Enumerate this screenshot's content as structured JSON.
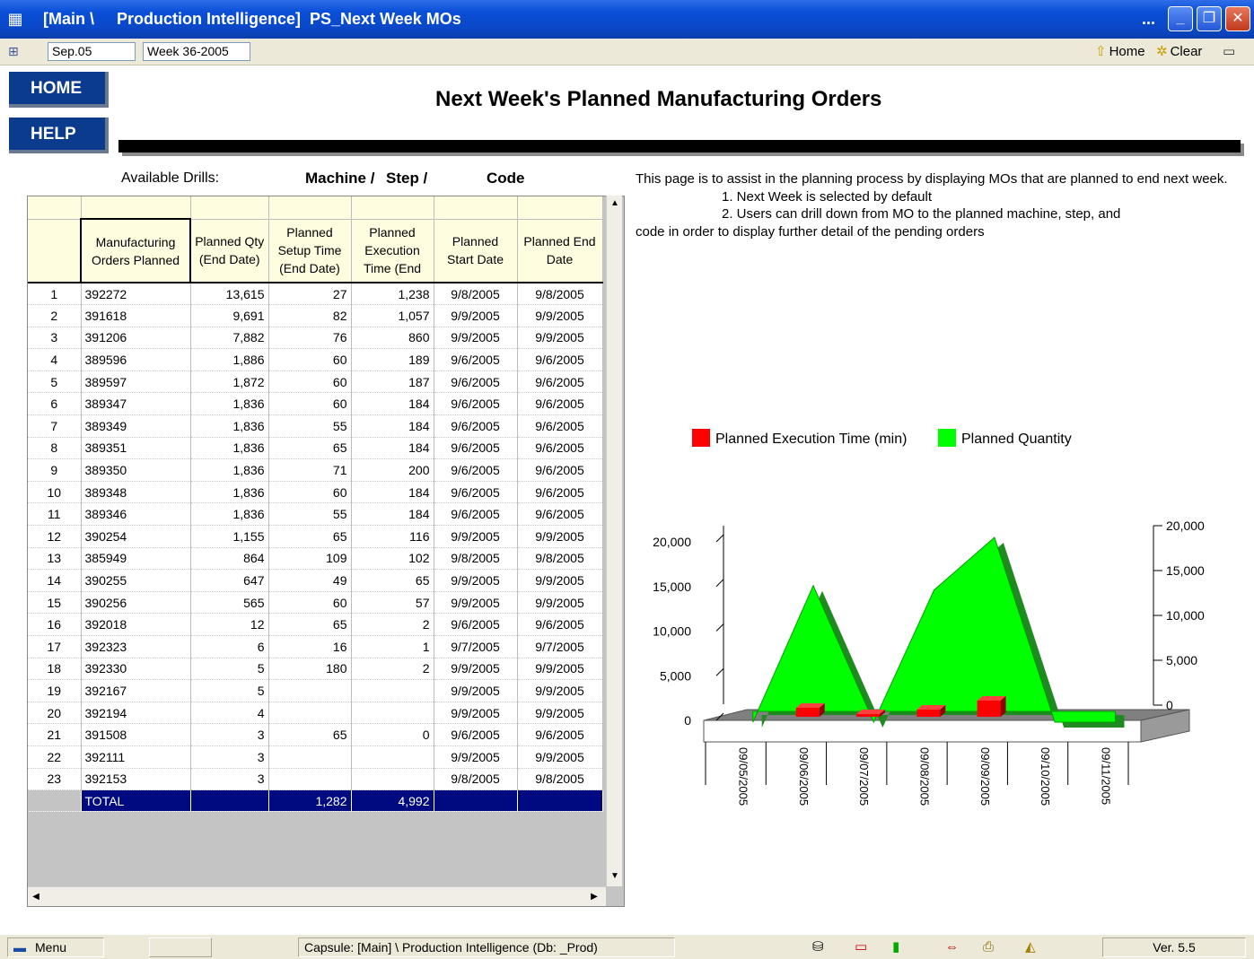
{
  "window": {
    "title": "[Main \\     Production Intelligence]  PS_Next Week MOs",
    "title_suffix": "...",
    "minimize": "_",
    "maximize": "❐",
    "close": "✕"
  },
  "toolbar": {
    "period": "Sep.05",
    "week": "Week 36-2005",
    "home_label": "Home",
    "clear_label": "Clear"
  },
  "nav": {
    "home": "HOME",
    "help": "HELP"
  },
  "page": {
    "title": "Next Week's Planned Manufacturing Orders"
  },
  "drills": {
    "label": "Available Drills:",
    "items": [
      "Machine /",
      "Step /",
      "Code"
    ]
  },
  "description": {
    "intro": "This page is to assist in the planning process by displaying MOs that are planned to end next week.",
    "items": [
      "1. Next Week is selected by default",
      "2. Users can drill down from MO to the planned machine, step, and"
    ],
    "tail": "code in order to display further detail of the pending orders"
  },
  "grid": {
    "headers": [
      "Manufacturing Orders Planned",
      "Planned Qty (End Date)",
      "Planned Setup Time (End Date)",
      "Planned Execution Time (End",
      "Planned Start Date",
      "Planned End Date"
    ],
    "rows": [
      [
        "1",
        "392272",
        "13,615",
        "27",
        "1,238",
        "9/8/2005",
        "9/8/2005"
      ],
      [
        "2",
        "391618",
        "9,691",
        "82",
        "1,057",
        "9/9/2005",
        "9/9/2005"
      ],
      [
        "3",
        "391206",
        "7,882",
        "76",
        "860",
        "9/9/2005",
        "9/9/2005"
      ],
      [
        "4",
        "389596",
        "1,886",
        "60",
        "189",
        "9/6/2005",
        "9/6/2005"
      ],
      [
        "5",
        "389597",
        "1,872",
        "60",
        "187",
        "9/6/2005",
        "9/6/2005"
      ],
      [
        "6",
        "389347",
        "1,836",
        "60",
        "184",
        "9/6/2005",
        "9/6/2005"
      ],
      [
        "7",
        "389349",
        "1,836",
        "55",
        "184",
        "9/6/2005",
        "9/6/2005"
      ],
      [
        "8",
        "389351",
        "1,836",
        "65",
        "184",
        "9/6/2005",
        "9/6/2005"
      ],
      [
        "9",
        "389350",
        "1,836",
        "71",
        "200",
        "9/6/2005",
        "9/6/2005"
      ],
      [
        "10",
        "389348",
        "1,836",
        "60",
        "184",
        "9/6/2005",
        "9/6/2005"
      ],
      [
        "11",
        "389346",
        "1,836",
        "55",
        "184",
        "9/6/2005",
        "9/6/2005"
      ],
      [
        "12",
        "390254",
        "1,155",
        "65",
        "116",
        "9/9/2005",
        "9/9/2005"
      ],
      [
        "13",
        "385949",
        "864",
        "109",
        "102",
        "9/8/2005",
        "9/8/2005"
      ],
      [
        "14",
        "390255",
        "647",
        "49",
        "65",
        "9/9/2005",
        "9/9/2005"
      ],
      [
        "15",
        "390256",
        "565",
        "60",
        "57",
        "9/9/2005",
        "9/9/2005"
      ],
      [
        "16",
        "392018",
        "12",
        "65",
        "2",
        "9/6/2005",
        "9/6/2005"
      ],
      [
        "17",
        "392323",
        "6",
        "16",
        "1",
        "9/7/2005",
        "9/7/2005"
      ],
      [
        "18",
        "392330",
        "5",
        "180",
        "2",
        "9/9/2005",
        "9/9/2005"
      ],
      [
        "19",
        "392167",
        "5",
        "",
        "",
        "9/9/2005",
        "9/9/2005"
      ],
      [
        "20",
        "392194",
        "4",
        "",
        "",
        "9/9/2005",
        "9/9/2005"
      ],
      [
        "21",
        "391508",
        "3",
        "65",
        "0",
        "9/6/2005",
        "9/6/2005"
      ],
      [
        "22",
        "392111",
        "3",
        "",
        "",
        "9/9/2005",
        "9/9/2005"
      ],
      [
        "23",
        "392153",
        "3",
        "",
        "",
        "9/8/2005",
        "9/8/2005"
      ]
    ],
    "total": [
      "",
      "TOTAL",
      "",
      "1,282",
      "4,992",
      "",
      ""
    ]
  },
  "chart_data": {
    "type": "area",
    "categories": [
      "09/05/2005",
      "09/06/2005",
      "09/07/2005",
      "09/08/2005",
      "09/09/2005",
      "09/10/2005",
      "09/11/2005"
    ],
    "series": [
      {
        "name": "Planned Execution Time (min)",
        "color": "#ff0000",
        "render": "bar",
        "axis": "right",
        "values": [
          0,
          1700,
          200,
          1500,
          2500,
          0,
          0
        ]
      },
      {
        "name": "Planned Quantity",
        "color": "#00ff00",
        "render": "area",
        "axis": "left",
        "values": [
          0,
          15300,
          0,
          14800,
          20700,
          0,
          0
        ]
      }
    ],
    "y_left": {
      "ticks": [
        "0",
        "5,000",
        "10,000",
        "15,000",
        "20,000"
      ],
      "range": [
        0,
        20000
      ]
    },
    "y_right": {
      "ticks": [
        "0",
        "5,000",
        "10,000",
        "15,000",
        "20,000"
      ],
      "range": [
        0,
        20000
      ]
    },
    "legend_position": "top"
  },
  "statusbar": {
    "menu": "Menu",
    "capsule": "Capsule:  [Main] \\      Production Intelligence  (Db:     _Prod)",
    "version": "Ver. 5.5"
  }
}
